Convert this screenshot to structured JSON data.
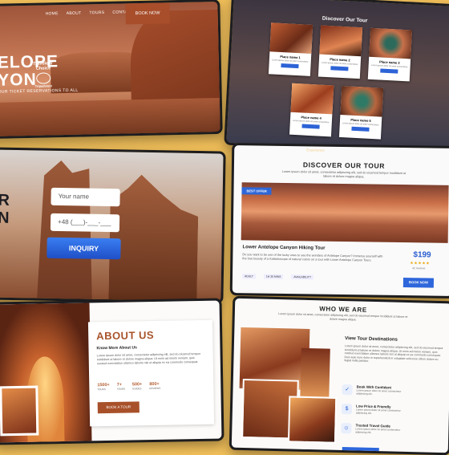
{
  "hero": {
    "nav": [
      "HOME",
      "ABOUT",
      "TOURS",
      "CONTACT US"
    ],
    "book_label": "BOOK NOW",
    "title_line1": "ELOPE",
    "title_line2": "YON",
    "subtitle": "OUR TICKET RESERVATIONS TO ALL",
    "award": "Travelers' Choice",
    "award_brand": "Tripadvisor"
  },
  "grid": {
    "title": "Discover Our Tour",
    "cards": [
      {
        "name": "Place name 1",
        "desc": "Lorem ipsum dolor sit amet consectetur"
      },
      {
        "name": "Place name 2",
        "desc": "Lorem ipsum dolor sit amet consectetur"
      },
      {
        "name": "Place name 3",
        "desc": "Lorem ipsum dolor sit amet consectetur"
      },
      {
        "name": "Place name 4",
        "desc": "Lorem ipsum dolor sit amet consectetur"
      },
      {
        "name": "Place name 5",
        "desc": "Lorem ipsum dolor sit amet consectetur"
      }
    ]
  },
  "form": {
    "letter1": "R",
    "letter2": "N",
    "name_placeholder": "Your name",
    "phone_placeholder": "+48 (___)-___-___",
    "submit_label": "INQUIRY"
  },
  "tour": {
    "top_text": "Experience",
    "title": "DISCOVER OUR TOUR",
    "intro": "Lorem ipsum dolor sit amet, consectetur adipiscing elit, sed do eiusmod tempor incididunt ut labore et dolore magna aliqua.",
    "ribbon": "BEST OFFER",
    "name": "Lower Antelope Canyon Hiking Tour",
    "desc": "Do you want to be one of the lucky ones to see the wonders of Antelope Canyon? Immerse yourself with the true beauty of a Kaleidoscope of natural colors on a tour with Lower Antelope Canyon Tours.",
    "chips": [
      "ADULT",
      "1H 30 MINS",
      "AVAILABILITY"
    ],
    "price": "$199",
    "stars": "★★★★★",
    "reviews": "42 reviews",
    "book_label": "BOOK NOW"
  },
  "about": {
    "title": "ABOUT US",
    "subtitle": "Know More About Us",
    "body": "Lorem ipsum dolor sit amet, consectetur adipiscing elit, sed do eiusmod tempor incididunt ut labore et dolore magna aliqua. Ut enim ad minim veniam, quis nostrud exercitation ullamco laboris nisi ut aliquip ex ea commodo consequat.",
    "stats": [
      {
        "value": "1500+",
        "label": "TOURS"
      },
      {
        "value": "7+",
        "label": "YEARS"
      },
      {
        "value": "500+",
        "label": "GUIDES"
      },
      {
        "value": "800+",
        "label": "REVIEWS"
      }
    ],
    "button": "BOOK A TOUR"
  },
  "who": {
    "title": "WHO WE ARE",
    "intro": "Lorem ipsum dolor sit amet, consectetur adipiscing elit, sed do eiusmod tempor incididunt ut labore et dolore magna aliqua.",
    "subtitle": "View Tour Destinations",
    "body": "Lorem ipsum dolor sit amet, consectetur adipiscing elit, sed do eiusmod tempor incididunt ut labore et dolore magna aliqua. Ut enim ad minim veniam, quis nostrud exercitation ullamco laboris nisi ut aliquip ex ea commodo consequat. Duis aute irure dolor in reprehenderit in voluptate velit esse cillum dolore eu fugiat nulla pariatur.",
    "features": [
      {
        "title": "Book With Confident",
        "desc": "Lorem ipsum dolor sit amet consectetur adipiscing elit."
      },
      {
        "title": "Low Price & Friendly",
        "desc": "Lorem ipsum dolor sit amet consectetur adipiscing elit."
      },
      {
        "title": "Trusted Travel Guide",
        "desc": "Lorem ipsum dolor sit amet consectetur adipiscing elit."
      }
    ]
  }
}
